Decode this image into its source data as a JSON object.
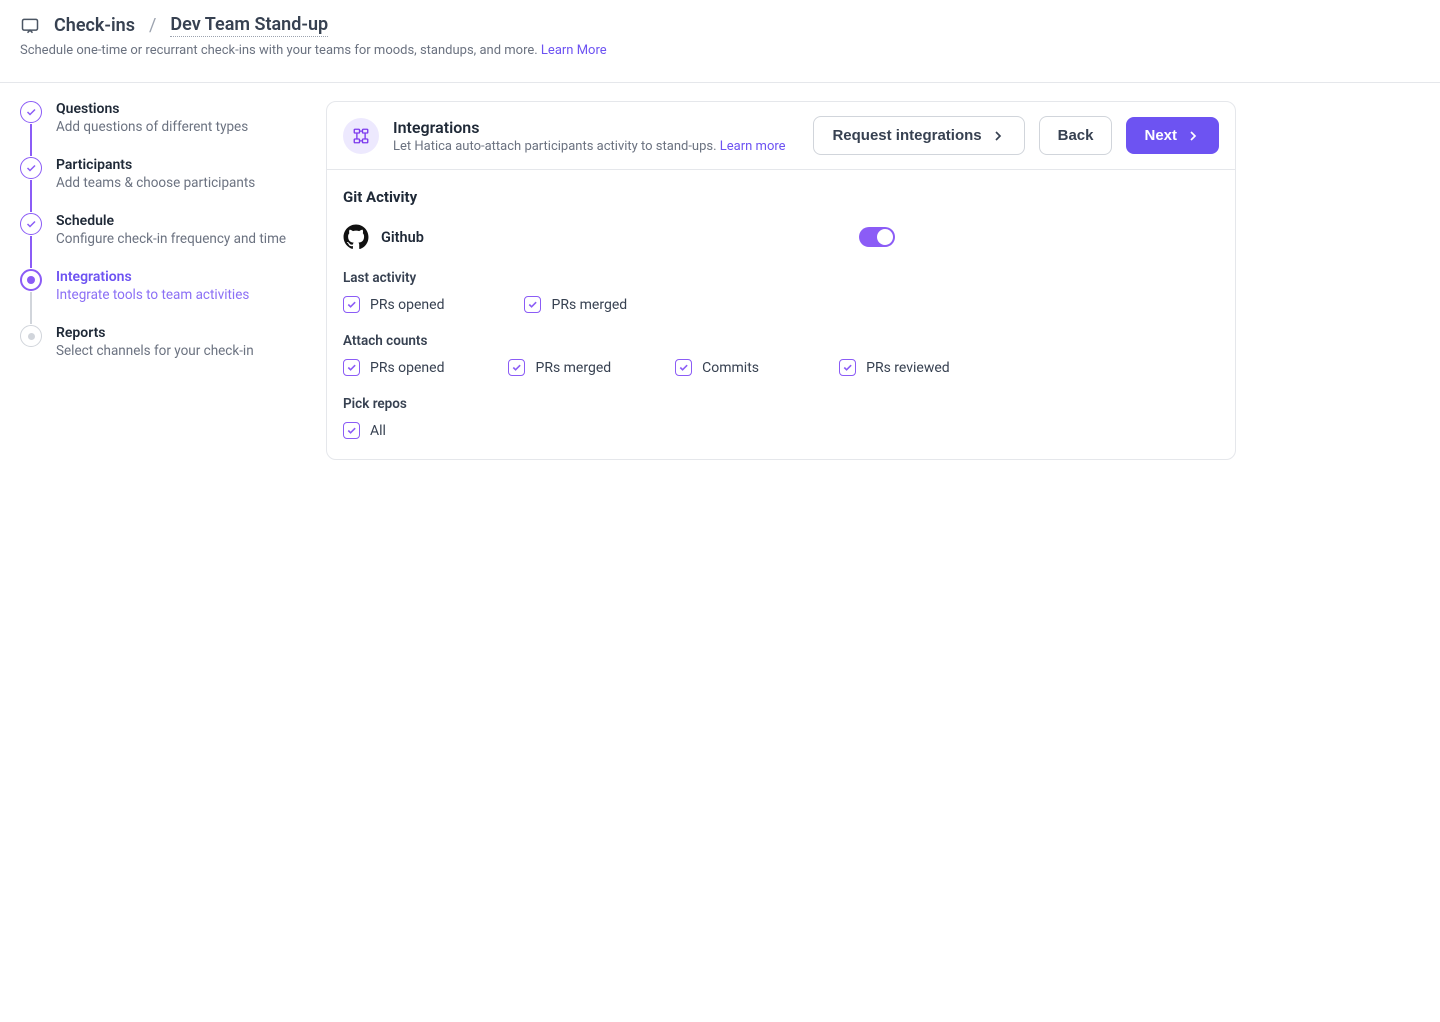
{
  "header": {
    "breadcrumb_root": "Check-ins",
    "breadcrumb_current": "Dev Team Stand-up",
    "description": "Schedule one-time or recurrant check-ins with your teams for moods, standups, and more. ",
    "learn_more": "Learn More"
  },
  "steps": [
    {
      "title": "Questions",
      "desc": "Add questions of different types"
    },
    {
      "title": "Participants",
      "desc": "Add teams & choose participants"
    },
    {
      "title": "Schedule",
      "desc": "Configure check-in frequency and time"
    },
    {
      "title": "Integrations",
      "desc": "Integrate tools to team activities"
    },
    {
      "title": "Reports",
      "desc": "Select channels for your check-in"
    }
  ],
  "panel": {
    "title": "Integrations",
    "subtitle": "Let Hatica auto-attach participants activity to stand-ups. ",
    "learn_more": "Learn more",
    "request_btn": "Request integrations",
    "back_btn": "Back",
    "next_btn": "Next"
  },
  "git": {
    "section_title": "Git Activity",
    "provider": "Github",
    "groups": {
      "last_activity": {
        "label": "Last activity",
        "items": [
          "PRs opened",
          "PRs merged"
        ]
      },
      "attach_counts": {
        "label": "Attach counts",
        "items": [
          "PRs opened",
          "PRs merged",
          "Commits",
          "PRs reviewed"
        ]
      },
      "pick_repos": {
        "label": "Pick repos",
        "items": [
          "All"
        ]
      }
    }
  }
}
